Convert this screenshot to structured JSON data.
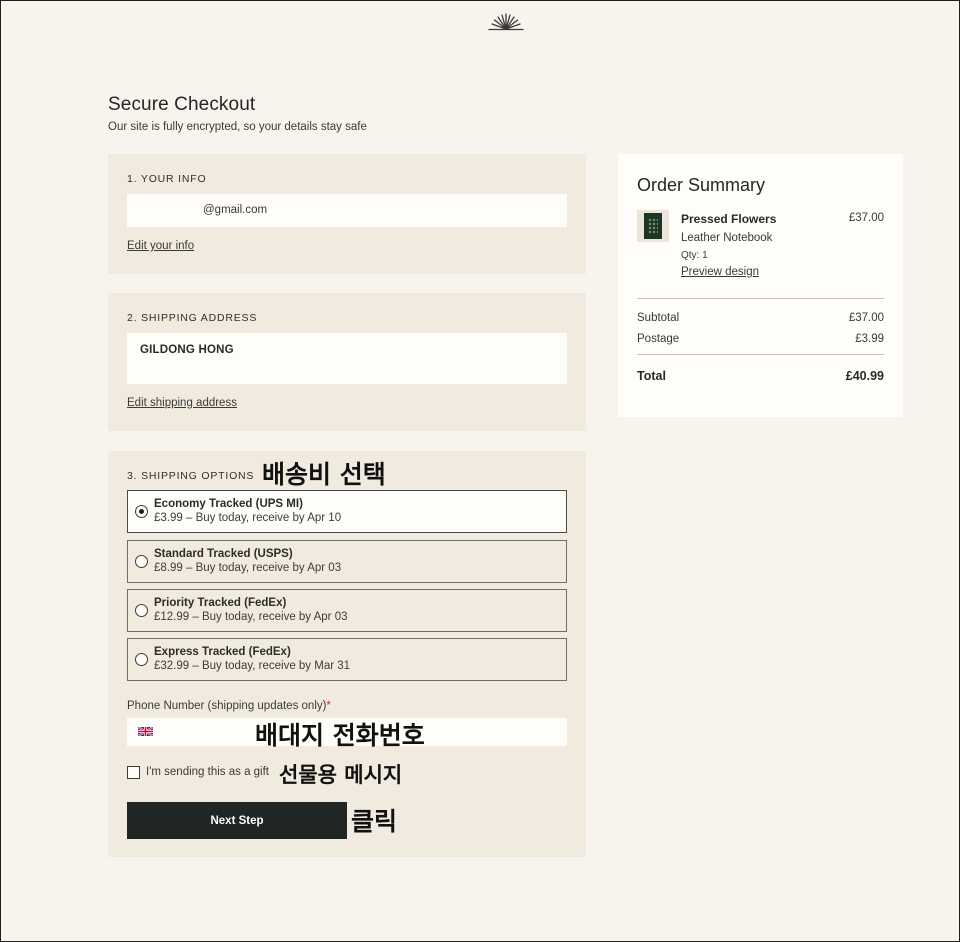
{
  "header": {
    "logo_icon": "sunburst-logo-icon"
  },
  "page": {
    "title": "Secure Checkout",
    "subtitle": "Our site is fully encrypted, so your details stay safe"
  },
  "your_info": {
    "heading": "1. YOUR INFO",
    "email": "@gmail.com",
    "edit_link": "Edit your info"
  },
  "shipping_address": {
    "heading": "2. SHIPPING ADDRESS",
    "name": "GILDONG HONG",
    "edit_link": "Edit shipping address"
  },
  "shipping_options": {
    "heading": "3. SHIPPING OPTIONS",
    "options": [
      {
        "name": "Economy Tracked (UPS MI)",
        "desc": "£3.99 – Buy today, receive by Apr 10",
        "selected": true
      },
      {
        "name": "Standard Tracked (USPS)",
        "desc": "£8.99 – Buy today, receive by Apr 03",
        "selected": false
      },
      {
        "name": "Priority Tracked (FedEx)",
        "desc": "£12.99 – Buy today, receive by Apr 03",
        "selected": false
      },
      {
        "name": "Express Tracked (FedEx)",
        "desc": "£32.99 – Buy today, receive by Mar 31",
        "selected": false
      }
    ],
    "phone_label": "Phone Number (shipping updates only)",
    "phone_required_mark": "*",
    "phone_flag_icon": "uk-flag-icon",
    "gift_label": "I'm sending this as a gift",
    "next_button": "Next Step"
  },
  "annotations": {
    "shipping_fee": "배송비 선택",
    "phone": "배대지 전화번호",
    "gift": "선물용 메시지",
    "click": "클릭"
  },
  "order_summary": {
    "title": "Order Summary",
    "product": {
      "name": "Pressed Flowers",
      "price": "£37.00",
      "type": "Leather Notebook",
      "qty": "Qty: 1",
      "preview_link": "Preview design"
    },
    "subtotal_label": "Subtotal",
    "subtotal_value": "£37.00",
    "postage_label": "Postage",
    "postage_value": "£3.99",
    "total_label": "Total",
    "total_value": "£40.99"
  }
}
